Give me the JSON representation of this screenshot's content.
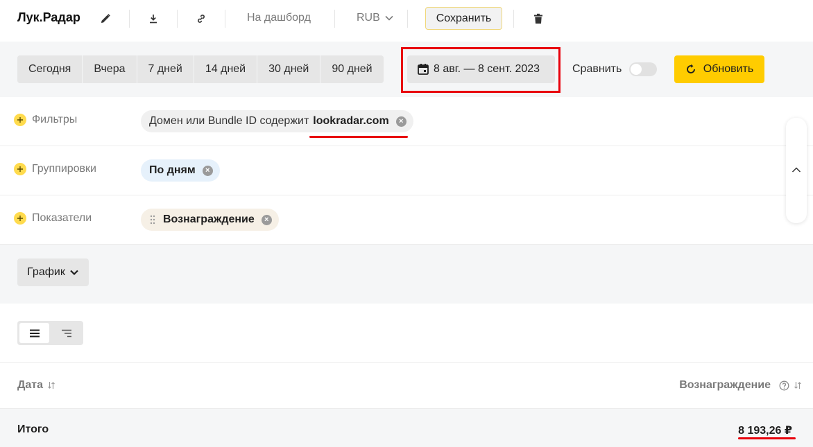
{
  "header": {
    "title": "Лук.Радар",
    "dashboard_link": "На дашборд",
    "currency": "RUB",
    "save_label": "Сохранить"
  },
  "datebar": {
    "presets": [
      "Сегодня",
      "Вчера",
      "7 дней",
      "14 дней",
      "30 дней",
      "90 дней"
    ],
    "range": "8 авг. — 8 сент. 2023",
    "compare_label": "Сравнить",
    "refresh_label": "Обновить"
  },
  "filters": {
    "label": "Фильтры",
    "chip_prefix": "Домен или Bundle ID содержит",
    "chip_value": "lookradar.com"
  },
  "groupings": {
    "label": "Группировки",
    "chip": "По дням"
  },
  "metrics": {
    "label": "Показатели",
    "chip": "Вознаграждение"
  },
  "chart": {
    "button_label": "График"
  },
  "table": {
    "col_date": "Дата",
    "col_reward": "Вознаграждение",
    "total_label": "Итого",
    "total_value": "8 193,26 ₽"
  },
  "colors": {
    "accent_yellow": "#ffcc00",
    "highlight_red": "#e8000b"
  }
}
